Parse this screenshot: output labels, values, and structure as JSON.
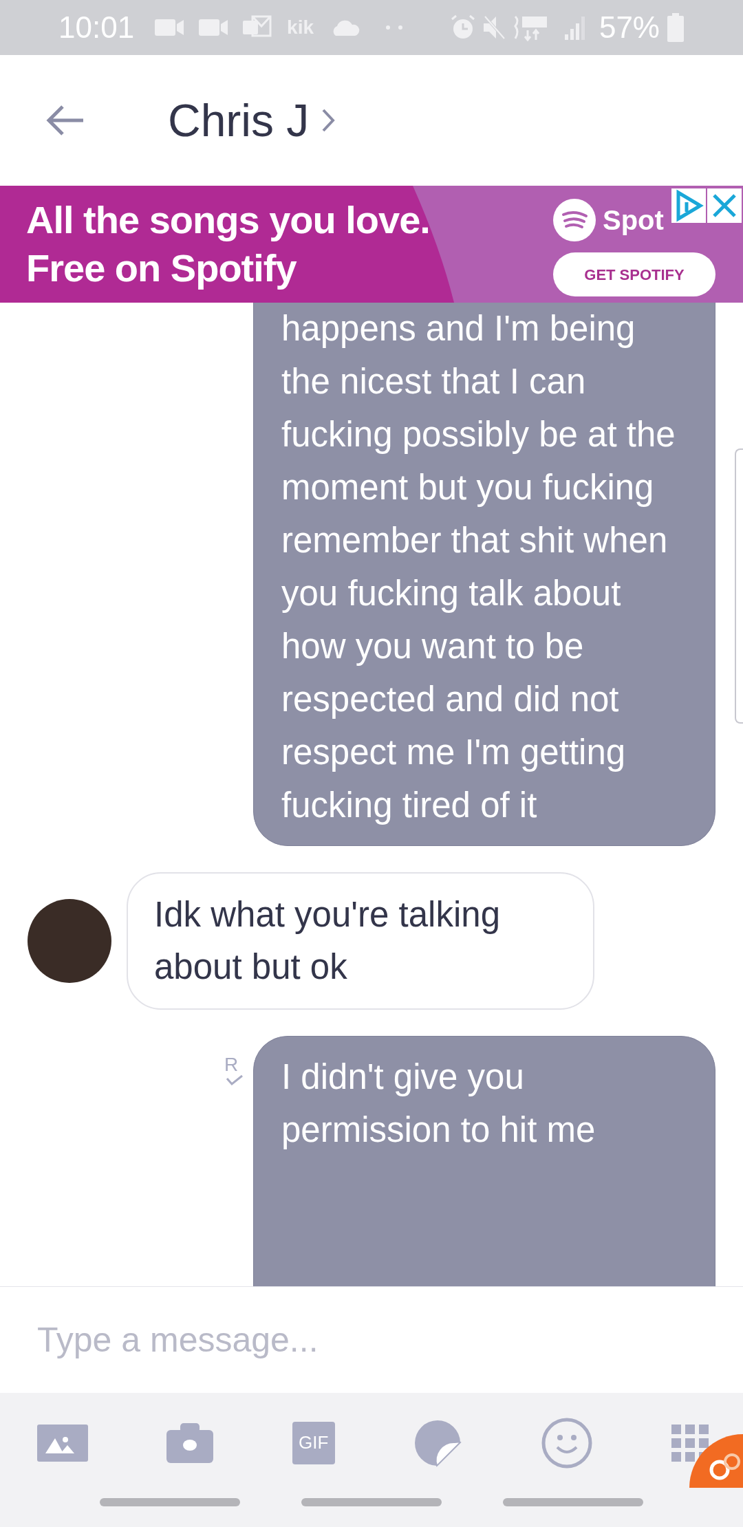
{
  "status_bar": {
    "time": "10:01",
    "kik": "kik",
    "battery": "57%"
  },
  "header": {
    "title": "Chris J"
  },
  "ad": {
    "headline": "All the songs you love.",
    "subline": "Free on Spotify",
    "brand": "Spot",
    "cta": "GET SPOTIFY"
  },
  "messages": [
    {
      "kind": "sent",
      "text": "happens and I'm being the nicest that I can fucking possibly be at the moment but you fucking remember that shit when you fucking talk about how you want to be respected and did not respect me I'm getting fucking tired of it",
      "read": false,
      "clipped_top": true
    },
    {
      "kind": "received",
      "text": "Idk what you're talking about but ok"
    },
    {
      "kind": "sent",
      "text": "I didn't give you permission to hit me",
      "read": true,
      "read_mark": "R",
      "clipped_top": false
    }
  ],
  "composer": {
    "placeholder": "Type a message..."
  },
  "toolbar": {
    "gif": "GIF"
  }
}
